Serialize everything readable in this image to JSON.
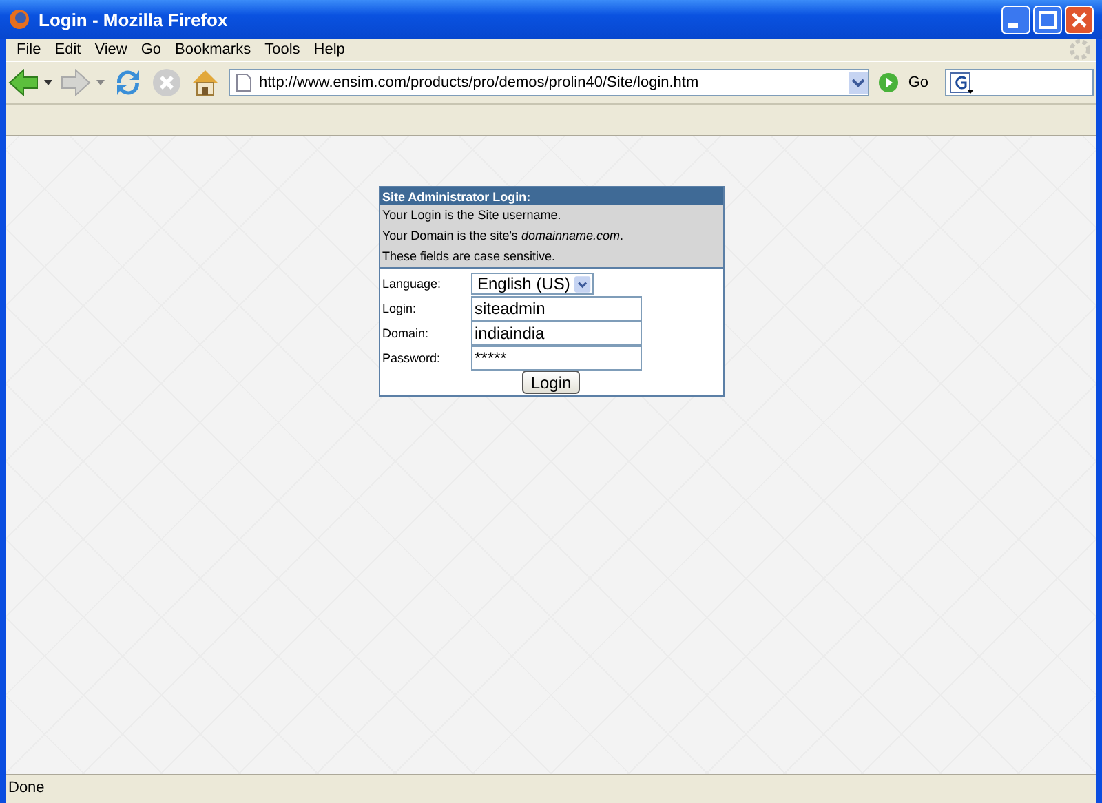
{
  "window": {
    "title": "Login - Mozilla Firefox"
  },
  "menu": [
    "File",
    "Edit",
    "View",
    "Go",
    "Bookmarks",
    "Tools",
    "Help"
  ],
  "toolbar": {
    "url": "http://www.ensim.com/products/pro/demos/prolin40/Site/login.htm",
    "go_label": "Go"
  },
  "login_form": {
    "title": "Site Administrator Login:",
    "notes": [
      "Your Login is the Site username.",
      "Your Domain is the site's *domainname.com*.",
      "These fields are case sensitive."
    ],
    "fields": [
      {
        "kind": "select",
        "label": "Language:",
        "value": "English (US)"
      },
      {
        "kind": "text",
        "label": "Login:",
        "value": "siteadmin"
      },
      {
        "kind": "text",
        "label": "Domain:",
        "value": "indiaindia"
      },
      {
        "kind": "password",
        "label": "Password:",
        "value": "*****"
      }
    ],
    "submit": "Login"
  },
  "status_bar": "Done"
}
